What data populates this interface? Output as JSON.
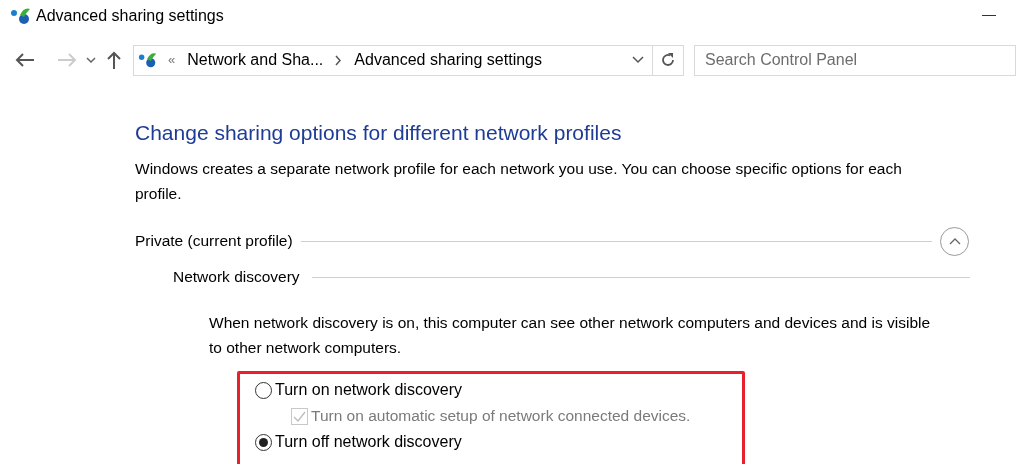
{
  "window": {
    "title": "Advanced sharing settings"
  },
  "address_bar": {
    "overflow": "«",
    "breadcrumbs": [
      {
        "label": "Network and Sha..."
      },
      {
        "label": "Advanced sharing settings"
      }
    ]
  },
  "search": {
    "placeholder": "Search Control Panel"
  },
  "heading": "Change sharing options for different network profiles",
  "intro": "Windows creates a separate network profile for each network you use. You can choose specific options for each profile.",
  "profile": {
    "label": "Private (current profile)",
    "expanded": true
  },
  "section": {
    "label": "Network discovery",
    "description": "When network discovery is on, this computer can see other network computers and devices and is visible to other network computers.",
    "options": [
      {
        "kind": "radio",
        "label": "Turn on network discovery",
        "selected": false
      },
      {
        "kind": "checkbox",
        "label": "Turn on automatic setup of network connected devices.",
        "checked": true,
        "disabled": true
      },
      {
        "kind": "radio",
        "label": "Turn off network discovery",
        "selected": true
      }
    ]
  }
}
